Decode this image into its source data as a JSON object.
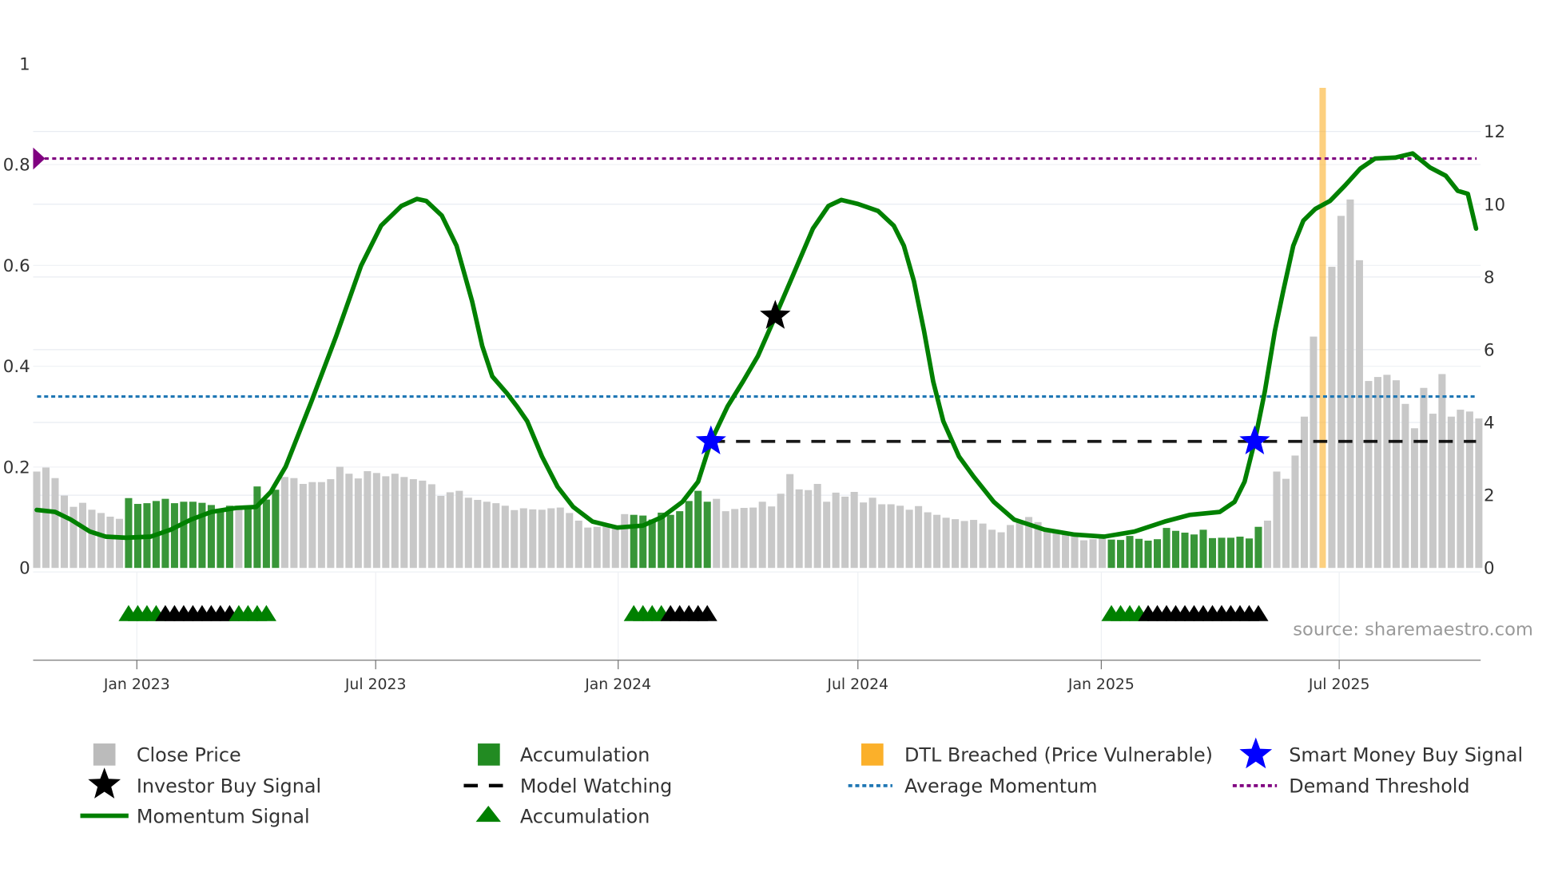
{
  "chart_data": {
    "type": "bar",
    "title": "",
    "source": "source: sharemaestro.com",
    "left_axis": {
      "ticks": [
        "0",
        "0.2",
        "0.4",
        "0.6",
        "0.8",
        "1"
      ],
      "tick_values": [
        0,
        0.2,
        0.4,
        0.6,
        0.8,
        1
      ],
      "ylim": [
        0,
        1
      ]
    },
    "right_axis": {
      "ticks": [
        "0",
        "2",
        "4",
        "6",
        "8",
        "10",
        "12"
      ],
      "tick_values": [
        0,
        2,
        4,
        6,
        8,
        10,
        12
      ],
      "ylim": [
        0,
        13.8
      ]
    },
    "x_ticks": [
      {
        "label": "Jan 2023",
        "week": 11.9
      },
      {
        "label": "Jul 2023",
        "week": 37.9
      },
      {
        "label": "Jan 2024",
        "week": 64.3
      },
      {
        "label": "Jul 2024",
        "week": 90.4
      },
      {
        "label": "Jan 2025",
        "week": 116.9
      },
      {
        "label": "Jul 2025",
        "week": 142.8
      }
    ],
    "close_price": [
      2.65,
      2.76,
      2.47,
      1.99,
      1.68,
      1.79,
      1.6,
      1.51,
      1.41,
      1.35,
      1.92,
      1.76,
      1.78,
      1.84,
      1.9,
      1.78,
      1.82,
      1.82,
      1.79,
      1.73,
      1.6,
      1.71,
      1.68,
      1.71,
      2.24,
      1.88,
      2.15,
      2.5,
      2.47,
      2.31,
      2.36,
      2.36,
      2.44,
      2.78,
      2.59,
      2.46,
      2.66,
      2.61,
      2.52,
      2.59,
      2.5,
      2.44,
      2.4,
      2.3,
      1.98,
      2.08,
      2.12,
      1.93,
      1.87,
      1.82,
      1.78,
      1.71,
      1.59,
      1.64,
      1.61,
      1.6,
      1.64,
      1.66,
      1.51,
      1.3,
      1.11,
      1.13,
      1.15,
      1.17,
      1.48,
      1.46,
      1.44,
      1.33,
      1.52,
      1.46,
      1.56,
      1.84,
      2.12,
      1.82,
      1.9,
      1.56,
      1.62,
      1.65,
      1.66,
      1.82,
      1.69,
      2.04,
      2.58,
      2.16,
      2.14,
      2.31,
      1.82,
      2.07,
      1.96,
      2.09,
      1.8,
      1.93,
      1.75,
      1.75,
      1.71,
      1.6,
      1.7,
      1.53,
      1.46,
      1.38,
      1.34,
      1.29,
      1.32,
      1.22,
      1.05,
      0.98,
      1.18,
      1.3,
      1.4,
      1.26,
      1.06,
      0.99,
      0.94,
      0.92,
      0.76,
      0.79,
      0.84,
      0.78,
      0.77,
      0.88,
      0.8,
      0.75,
      0.79,
      1.1,
      1.02,
      0.97,
      0.92,
      1.05,
      0.82,
      0.83,
      0.83,
      0.86,
      0.81,
      1.13,
      1.3,
      2.65,
      2.45,
      3.09,
      4.16,
      6.36,
      null,
      8.28,
      9.68,
      10.13,
      8.46,
      5.14,
      5.25,
      5.31,
      5.16,
      4.51,
      3.84,
      4.95,
      4.24,
      5.33,
      4.16,
      4.35,
      4.3,
      4.11
    ],
    "accumulation_weeks": [
      [
        11,
        22
      ],
      [
        24,
        27
      ],
      [
        66,
        74
      ],
      [
        118,
        134
      ]
    ],
    "dtl_breached": {
      "week": 141,
      "value": 13.2
    },
    "momentum_signal": [
      [
        1,
        0.115
      ],
      [
        3,
        0.111
      ],
      [
        4.7,
        0.096
      ],
      [
        6.8,
        0.072
      ],
      [
        8.5,
        0.062
      ],
      [
        10.7,
        0.06
      ],
      [
        13.4,
        0.062
      ],
      [
        15.6,
        0.076
      ],
      [
        17.8,
        0.096
      ],
      [
        20,
        0.111
      ],
      [
        22.7,
        0.119
      ],
      [
        24.9,
        0.121
      ],
      [
        26.5,
        0.151
      ],
      [
        28.1,
        0.201
      ],
      [
        30.9,
        0.33
      ],
      [
        33.6,
        0.46
      ],
      [
        36.3,
        0.599
      ],
      [
        38.5,
        0.679
      ],
      [
        40.7,
        0.718
      ],
      [
        42.4,
        0.732
      ],
      [
        43.4,
        0.728
      ],
      [
        45.1,
        0.699
      ],
      [
        46.7,
        0.639
      ],
      [
        48.4,
        0.529
      ],
      [
        49.5,
        0.44
      ],
      [
        50.6,
        0.38
      ],
      [
        52.2,
        0.346
      ],
      [
        53.3,
        0.32
      ],
      [
        54.4,
        0.291
      ],
      [
        56,
        0.221
      ],
      [
        57.7,
        0.161
      ],
      [
        59.4,
        0.121
      ],
      [
        61.5,
        0.092
      ],
      [
        64.2,
        0.08
      ],
      [
        67,
        0.084
      ],
      [
        69.1,
        0.101
      ],
      [
        71.3,
        0.131
      ],
      [
        73,
        0.171
      ],
      [
        74.4,
        0.251
      ],
      [
        76.2,
        0.32
      ],
      [
        77.9,
        0.37
      ],
      [
        79.5,
        0.42
      ],
      [
        81.2,
        0.49
      ],
      [
        83.3,
        0.579
      ],
      [
        85.5,
        0.673
      ],
      [
        87.2,
        0.718
      ],
      [
        88.6,
        0.73
      ],
      [
        90.4,
        0.722
      ],
      [
        92.6,
        0.708
      ],
      [
        94.3,
        0.679
      ],
      [
        95.4,
        0.639
      ],
      [
        96.5,
        0.569
      ],
      [
        97.6,
        0.47
      ],
      [
        98.6,
        0.37
      ],
      [
        99.7,
        0.291
      ],
      [
        101.4,
        0.221
      ],
      [
        103,
        0.181
      ],
      [
        105.2,
        0.131
      ],
      [
        107.4,
        0.096
      ],
      [
        110.7,
        0.076
      ],
      [
        114,
        0.066
      ],
      [
        117.2,
        0.062
      ],
      [
        120.5,
        0.072
      ],
      [
        123.8,
        0.092
      ],
      [
        126.5,
        0.105
      ],
      [
        129.8,
        0.111
      ],
      [
        131.4,
        0.131
      ],
      [
        132.5,
        0.171
      ],
      [
        133.6,
        0.251
      ],
      [
        134.7,
        0.35
      ],
      [
        135.8,
        0.47
      ],
      [
        136.7,
        0.549
      ],
      [
        137.8,
        0.639
      ],
      [
        138.9,
        0.689
      ],
      [
        140.2,
        0.712
      ],
      [
        141.8,
        0.728
      ],
      [
        143.4,
        0.758
      ],
      [
        145.1,
        0.792
      ],
      [
        146.7,
        0.812
      ],
      [
        148.9,
        0.814
      ],
      [
        150.8,
        0.822
      ],
      [
        152.7,
        0.794
      ],
      [
        154.4,
        0.778
      ],
      [
        155.7,
        0.748
      ],
      [
        156.8,
        0.742
      ],
      [
        157.7,
        0.673
      ]
    ],
    "average_momentum": 0.34,
    "demand_threshold": 0.812,
    "model_watching": {
      "value": 0.251,
      "from_week": 74.4,
      "to_week": 157.7
    },
    "smart_money_buy_signals": [
      [
        74.4,
        0.251
      ],
      [
        133.6,
        0.251
      ]
    ],
    "investor_buy_signals": [
      [
        81.4,
        0.5
      ]
    ],
    "triangle_markers": [
      {
        "color": "green",
        "from": 11,
        "to": 14
      },
      {
        "color": "black",
        "from": 15,
        "to": 22
      },
      {
        "color": "green",
        "from": 23,
        "to": 26
      },
      {
        "color": "green",
        "from": 66,
        "to": 69
      },
      {
        "color": "black",
        "from": 70,
        "to": 74
      },
      {
        "color": "green",
        "from": 118,
        "to": 121
      },
      {
        "color": "black",
        "from": 122,
        "to": 134
      }
    ],
    "colors": {
      "close": "#c8c8c8",
      "accumulation": "#228b22",
      "dtl": "#fbb02a",
      "momentum": "#008000",
      "average": "#1f77b4",
      "threshold": "#800080",
      "smart_money": "#0000ff",
      "investor": "#000000"
    },
    "legend": [
      {
        "label": "Close Price",
        "icon": "gray-square-icon"
      },
      {
        "label": "Accumulation",
        "icon": "green-square-icon"
      },
      {
        "label": "DTL Breached (Price Vulnerable)",
        "icon": "orange-square-icon"
      },
      {
        "label": "Smart Money Buy Signal",
        "icon": "blue-star-icon"
      },
      {
        "label": "Investor Buy Signal",
        "icon": "black-star-icon"
      },
      {
        "label": "Model Watching",
        "icon": "dashed-line-icon"
      },
      {
        "label": "Average Momentum",
        "icon": "dotted-blue-line-icon"
      },
      {
        "label": "Demand Threshold",
        "icon": "dotted-purple-line-icon"
      },
      {
        "label": "Momentum Signal",
        "icon": "green-line-icon"
      },
      {
        "label": "Accumulation",
        "icon": "green-triangle-icon"
      }
    ]
  }
}
